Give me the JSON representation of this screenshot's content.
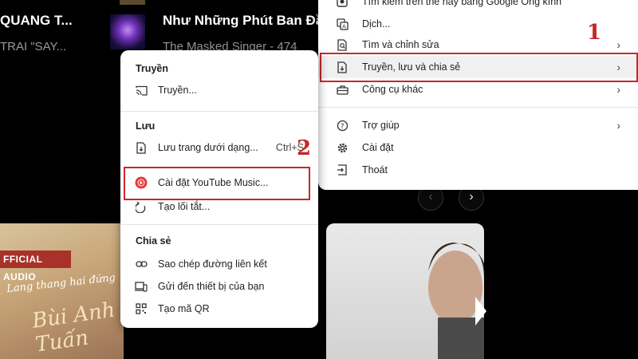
{
  "background": {
    "row1_title_left": "QUANG T...",
    "row1_sub_left": "TRAI \"SAY...",
    "row1_title": "Như Những Phút Ban Đầu (",
    "row1_sub": "The Masked Singer - 474",
    "album_label": "FFICIAL AUDIO",
    "album_script": "Lang thang hai đứng",
    "album_script2": "Bùi Anh Tuấn",
    "nav_prev": "‹",
    "nav_next": "›"
  },
  "main_menu": {
    "items": [
      {
        "label": "Tìm kiếm trên thẻ này bằng Google Ống kính",
        "icon": "lens-icon"
      },
      {
        "label": "Dịch...",
        "icon": "translate-icon"
      },
      {
        "label": "Tìm và chỉnh sửa",
        "icon": "find-edit-icon",
        "arrow": "›"
      },
      {
        "label": "Truyền, lưu và chia sẻ",
        "icon": "cast-save-share-icon",
        "arrow": "›"
      },
      {
        "label": "Công cụ khác",
        "icon": "toolbox-icon",
        "arrow": "›"
      },
      {
        "label": "Trợ giúp",
        "icon": "help-icon",
        "arrow": "›"
      },
      {
        "label": "Cài đặt",
        "icon": "gear-icon"
      },
      {
        "label": "Thoát",
        "icon": "exit-icon"
      }
    ]
  },
  "sub_menu": {
    "sections": {
      "cast": "Truyền",
      "save": "Lưu",
      "share": "Chia sẻ"
    },
    "items": {
      "cast": "Truyền...",
      "save_page": "Lưu trang dưới dạng...",
      "save_shortcut": "Ctrl+S",
      "install": "Cài đặt YouTube Music...",
      "shortcut": "Tạo lối tắt...",
      "copy_link": "Sao chép đường liên kết",
      "send_device": "Gửi đến thiết bị của bạn",
      "qr": "Tạo mã QR"
    }
  },
  "callouts": {
    "one": "1",
    "two": "2"
  },
  "colors": {
    "highlight": "#c62828",
    "youtube_red": "#e53935"
  }
}
